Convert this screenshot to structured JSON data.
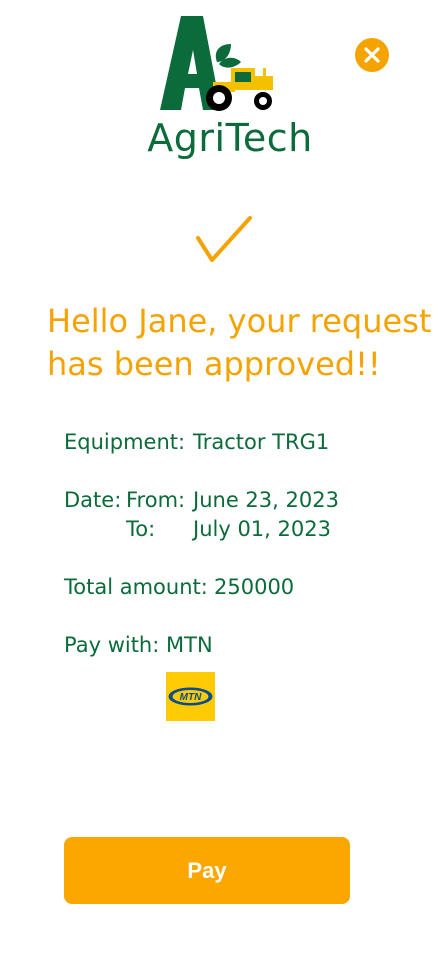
{
  "app": {
    "name": "AgriTech"
  },
  "header": {
    "close_icon": "close-icon"
  },
  "status": {
    "icon": "checkmark-icon",
    "headline": "Hello Jane, your request has been approved!!"
  },
  "details": {
    "equipment_label": "Equipment:",
    "equipment_value": "Tractor TRG1",
    "date_label": "Date:",
    "from_label": "From:",
    "from_value": "June 23, 2023",
    "to_label": "To:",
    "to_value": "July 01, 2023",
    "total_label": "Total amount:",
    "total_value": "250000",
    "pay_with_label": "Pay with:",
    "pay_with_value": "MTN",
    "payment_logo_text": "MTN"
  },
  "actions": {
    "pay_label": "Pay"
  },
  "colors": {
    "primary_green": "#0b6b3a",
    "accent_orange": "#f5a300",
    "button_orange": "#fca700",
    "mtn_yellow": "#ffcb05",
    "mtn_blue": "#0a4d8c"
  }
}
